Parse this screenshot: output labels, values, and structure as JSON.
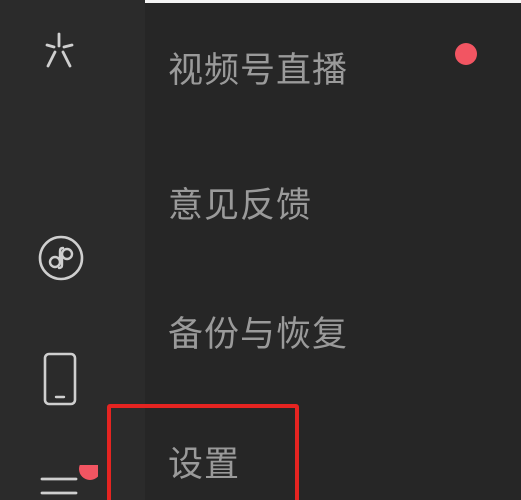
{
  "app": {
    "sidebar_icons": [
      "channels-icon",
      "mini-program-icon",
      "phone-icon",
      "menu-icon"
    ],
    "menu": {
      "items": [
        {
          "label": "视频号直播",
          "has_badge": true
        },
        {
          "label": "意见反馈",
          "has_badge": false
        },
        {
          "label": "备份与恢复",
          "has_badge": false
        },
        {
          "label": "设置",
          "has_badge": false,
          "highlighted": true
        }
      ]
    },
    "colors": {
      "sidebar_bg": "#2b2b2b",
      "menu_bg": "#262626",
      "text": "#9a9a9a",
      "badge": "#f25562",
      "highlight": "#e52421"
    }
  }
}
